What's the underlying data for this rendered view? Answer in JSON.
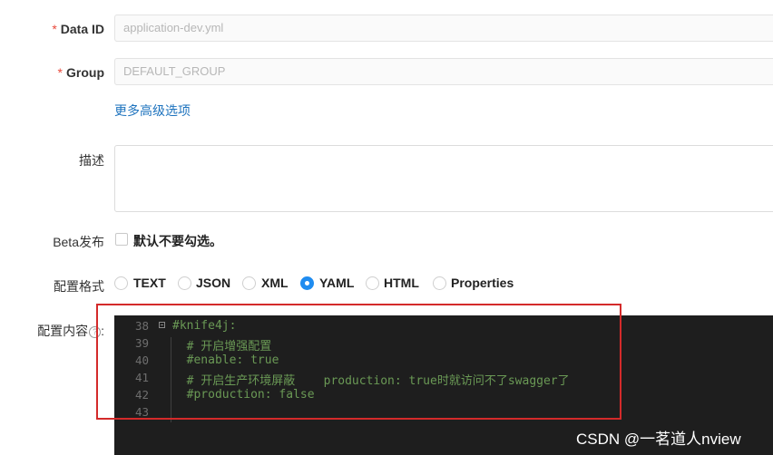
{
  "form": {
    "data_id": {
      "required_mark": "*",
      "label": "Data ID",
      "value": "application-dev.yml"
    },
    "group": {
      "required_mark": "*",
      "label": "Group",
      "value": "DEFAULT_GROUP"
    },
    "advanced_link": "更多高级选项",
    "description": {
      "label": "描述",
      "value": ""
    },
    "beta": {
      "label": "Beta发布",
      "checkbox_text": "默认不要勾选。",
      "checked": false
    },
    "format": {
      "label": "配置格式",
      "options": [
        "TEXT",
        "JSON",
        "XML",
        "YAML",
        "HTML",
        "Properties"
      ],
      "selected": "YAML"
    },
    "content": {
      "label": "配置内容",
      "help_glyph": "?",
      "colon": ":"
    }
  },
  "editor": {
    "lines": [
      {
        "number": "38",
        "text": "#knife4j:"
      },
      {
        "number": "39",
        "text": "  # 开启增强配置"
      },
      {
        "number": "40",
        "text": "  #enable: true"
      },
      {
        "number": "41",
        "text": "  # 开启生产环境屏蔽    production: true时就访问不了swagger了"
      },
      {
        "number": "42",
        "text": "  #production: false"
      },
      {
        "number": "43",
        "text": ""
      }
    ],
    "comment_color": "#6a9955",
    "background": "#1e1e1e"
  },
  "annotation": {
    "highlight_color": "#d42a2a"
  },
  "watermark": "CSDN @一茗道人nview"
}
